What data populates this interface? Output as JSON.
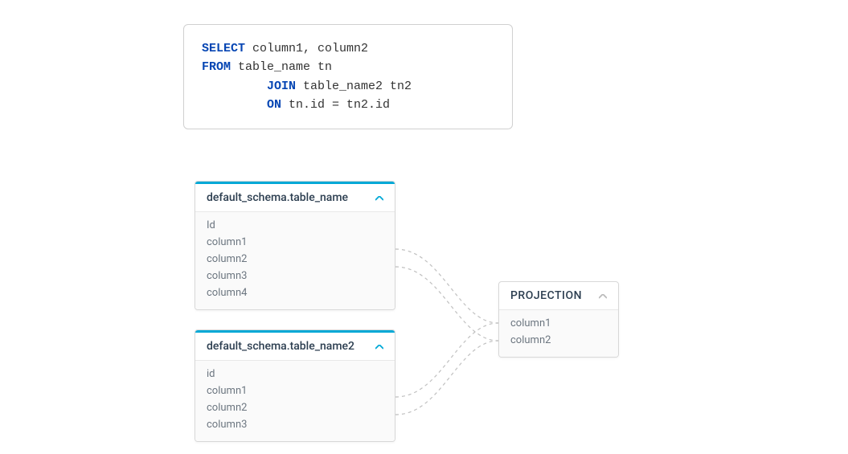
{
  "sql": {
    "keywords": {
      "select": "SELECT",
      "from": "FROM",
      "join": "JOIN",
      "on": "ON"
    },
    "line1_rest": " column1, column2",
    "line2_rest": " table_name tn",
    "line3_indent": "         ",
    "line3_rest": " table_name2 tn2",
    "line4_indent": "         ",
    "line4_rest": " tn.id = tn2.id"
  },
  "table1": {
    "title": "default_schema.table_name",
    "columns": [
      "Id",
      "column1",
      "column2",
      "column3",
      "column4"
    ]
  },
  "table2": {
    "title": "default_schema.table_name2",
    "columns": [
      "id",
      "column1",
      "column2",
      "column3"
    ]
  },
  "projection": {
    "title": "PROJECTION",
    "columns": [
      "column1",
      "column2"
    ]
  },
  "colors": {
    "accent": "#00a8d6",
    "keyword": "#0545b3",
    "text_muted": "#6c7680"
  }
}
